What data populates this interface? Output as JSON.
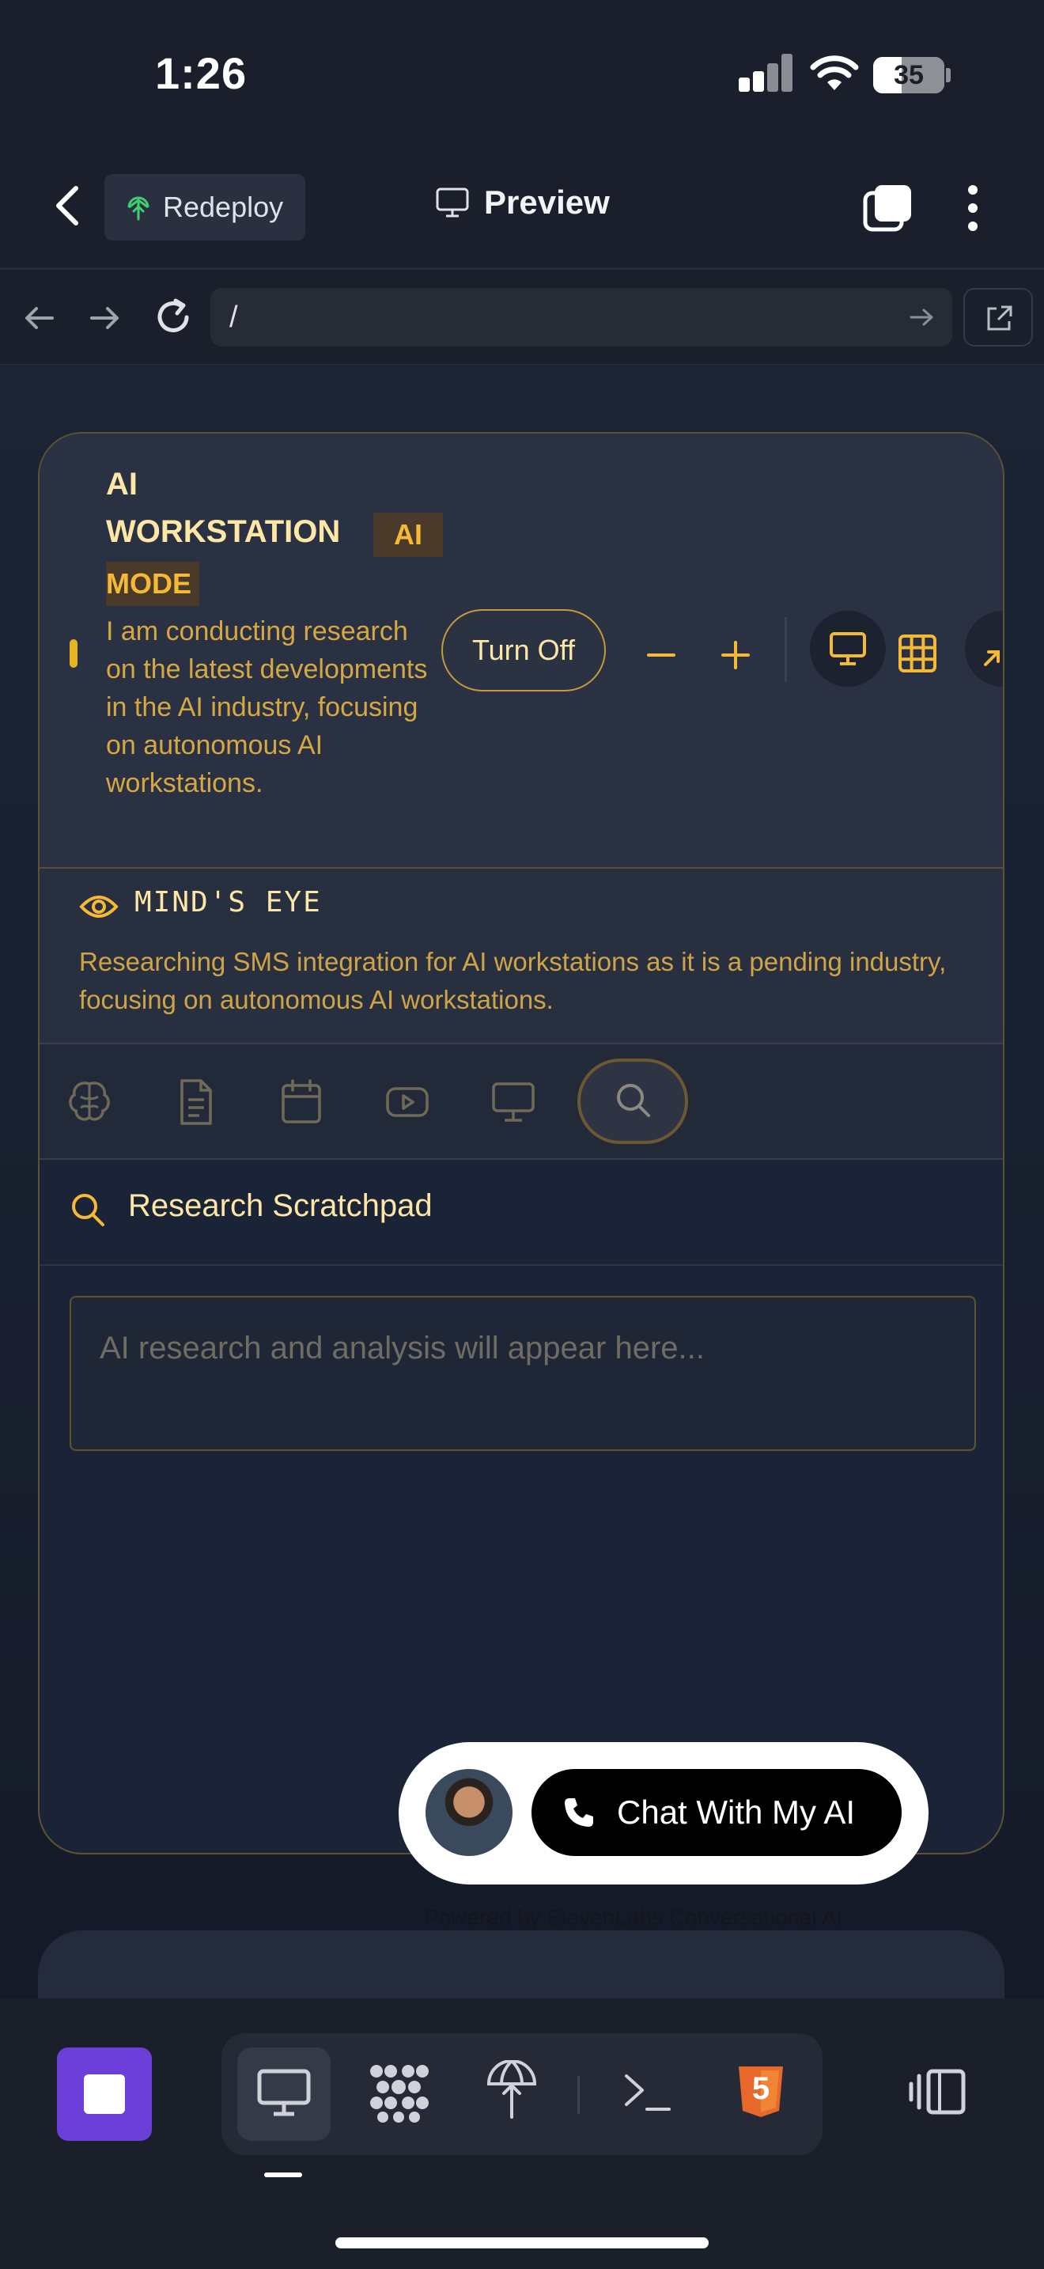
{
  "status_bar": {
    "time": "1:26",
    "battery": "35"
  },
  "header": {
    "redeploy_label": "Redeploy",
    "title": "Preview"
  },
  "browser": {
    "url": "/"
  },
  "workstation": {
    "title_line1": "AI",
    "title_line2": "WORKSTATION",
    "badge_line1": "AI",
    "badge_line2": "MODE",
    "description": "I am conducting research on the latest developments in the AI industry, focusing on autonomous AI workstations.",
    "turn_off_label": "Turn Off",
    "accent_color": "#f5b935"
  },
  "minds_eye": {
    "title": "MIND'S EYE",
    "text": "Researching SMS integration for AI workstations as it is a pending industry, focusing on autonomous AI workstations."
  },
  "tools": [
    {
      "icon": "brain-icon"
    },
    {
      "icon": "document-icon"
    },
    {
      "icon": "calendar-icon"
    },
    {
      "icon": "youtube-icon"
    },
    {
      "icon": "monitor-icon"
    },
    {
      "icon": "search-icon",
      "active": true
    }
  ],
  "scratchpad": {
    "title": "Research Scratchpad",
    "placeholder": "AI research and analysis will appear here..."
  },
  "chat_widget": {
    "button_label": "Chat With My AI",
    "powered_by": "Powered by ElevenLabs Conversational AI"
  },
  "bottom_bar": {
    "tabs": [
      "desktop-icon",
      "dots-cluster-icon",
      "deploy-icon",
      "terminal-icon",
      "html5-icon"
    ],
    "html5_badge": "5"
  }
}
